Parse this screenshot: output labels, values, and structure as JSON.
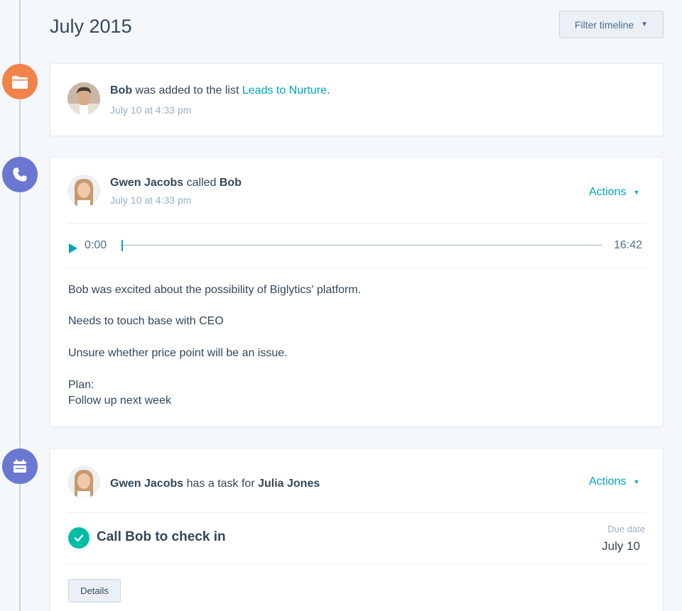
{
  "header": {
    "month": "July 2015",
    "filter_label": "Filter timeline"
  },
  "events": [
    {
      "type": "list",
      "icon": "folder-icon",
      "actor": "Bob",
      "verb": " was added to the list ",
      "list_name": "Leads to Nurture",
      "suffix": ".",
      "timestamp": "July 10 at 4:33 pm"
    },
    {
      "type": "call",
      "icon": "phone-icon",
      "actor": "Gwen Jacobs",
      "verb": " called ",
      "target": "Bob",
      "timestamp": "July 10 at 4:33 pm",
      "actions_label": "Actions",
      "audio": {
        "current": "0:00",
        "duration": "16:42",
        "progress": 0
      },
      "notes": [
        "Bob was excited about the possibility of Biglytics' platform.",
        "Needs to touch base with CEO",
        "Unsure whether price point will be an issue.",
        "Plan:",
        "Follow up next week"
      ]
    },
    {
      "type": "task",
      "icon": "calendar-icon",
      "actor": "Gwen Jacobs",
      "verb": " has a task for ",
      "target": "Julia Jones",
      "actions_label": "Actions",
      "task_title": "Call Bob  to check in",
      "due_label": "Due date",
      "due_value": "July 10",
      "details_label": "Details"
    }
  ],
  "colors": {
    "accent": "#00a4bd",
    "orange": "#f2834a",
    "purple": "#6a78d1",
    "success": "#00bda5"
  }
}
